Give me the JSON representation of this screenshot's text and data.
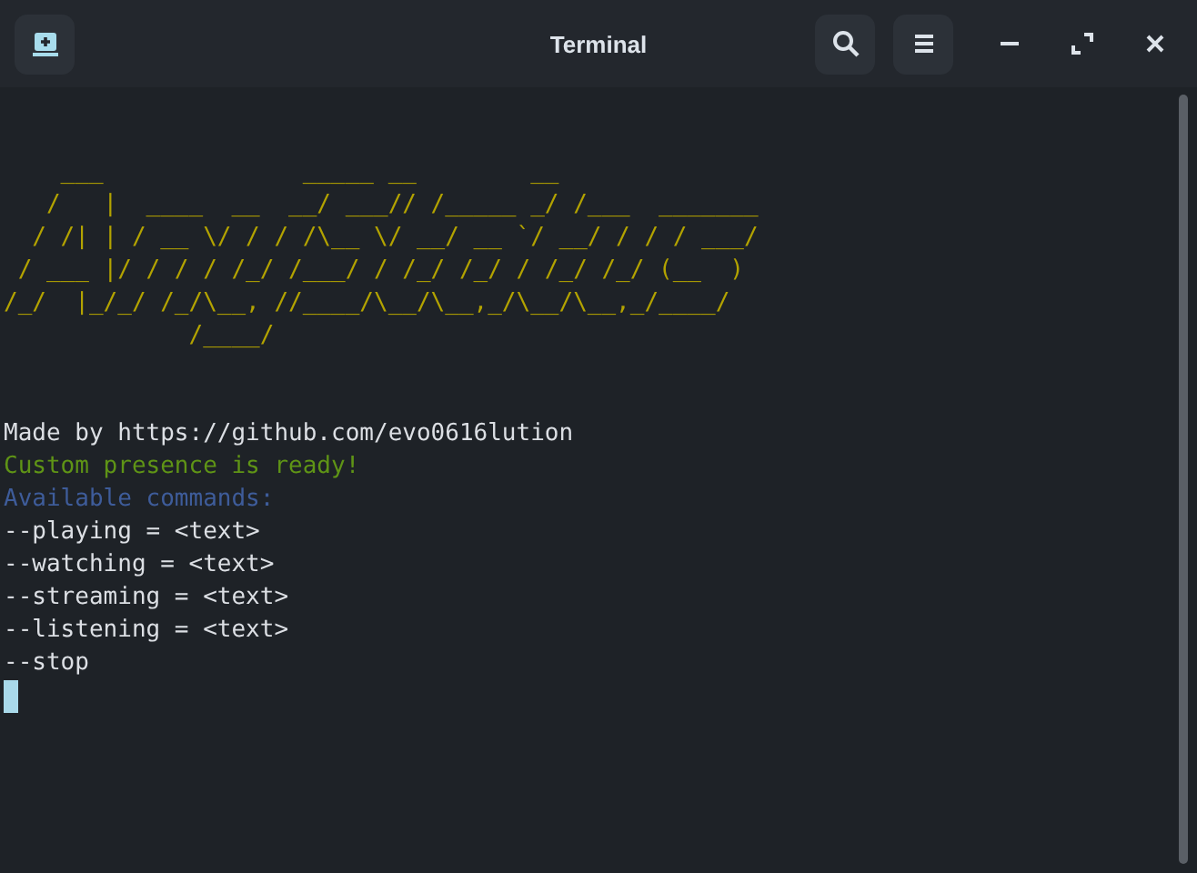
{
  "window": {
    "title": "Terminal"
  },
  "ascii_art": [
    "    ___              _____ __        __",
    "   /   |  ____  __  __/ ___// /_____ _/ /___  _______",
    "  / /| | / __ \\/ / / /\\__ \\/ __/ __ `/ __/ / / / ___/",
    " / ___ |/ / / / /_/ /___/ / /_/ /_/ / /_/ /_/ (__  )",
    "/_/  |_/_/ /_/\\__, //____/\\__/\\__,_/\\__/\\__,_/____/",
    "             /____/"
  ],
  "output": [
    {
      "text": "Made by https://github.com/evo0616lution",
      "color": "#dcdfe4"
    },
    {
      "text": "Custom presence is ready!",
      "color": "#5f9416"
    },
    {
      "text": "Available commands:",
      "color": "#3e5c9a"
    },
    {
      "text": "--playing = <text>",
      "color": "#dcdfe4"
    },
    {
      "text": "--watching = <text>",
      "color": "#dcdfe4"
    },
    {
      "text": "--streaming = <text>",
      "color": "#dcdfe4"
    },
    {
      "text": "--listening = <text>",
      "color": "#dcdfe4"
    },
    {
      "text": "--stop",
      "color": "#dcdfe4"
    }
  ]
}
